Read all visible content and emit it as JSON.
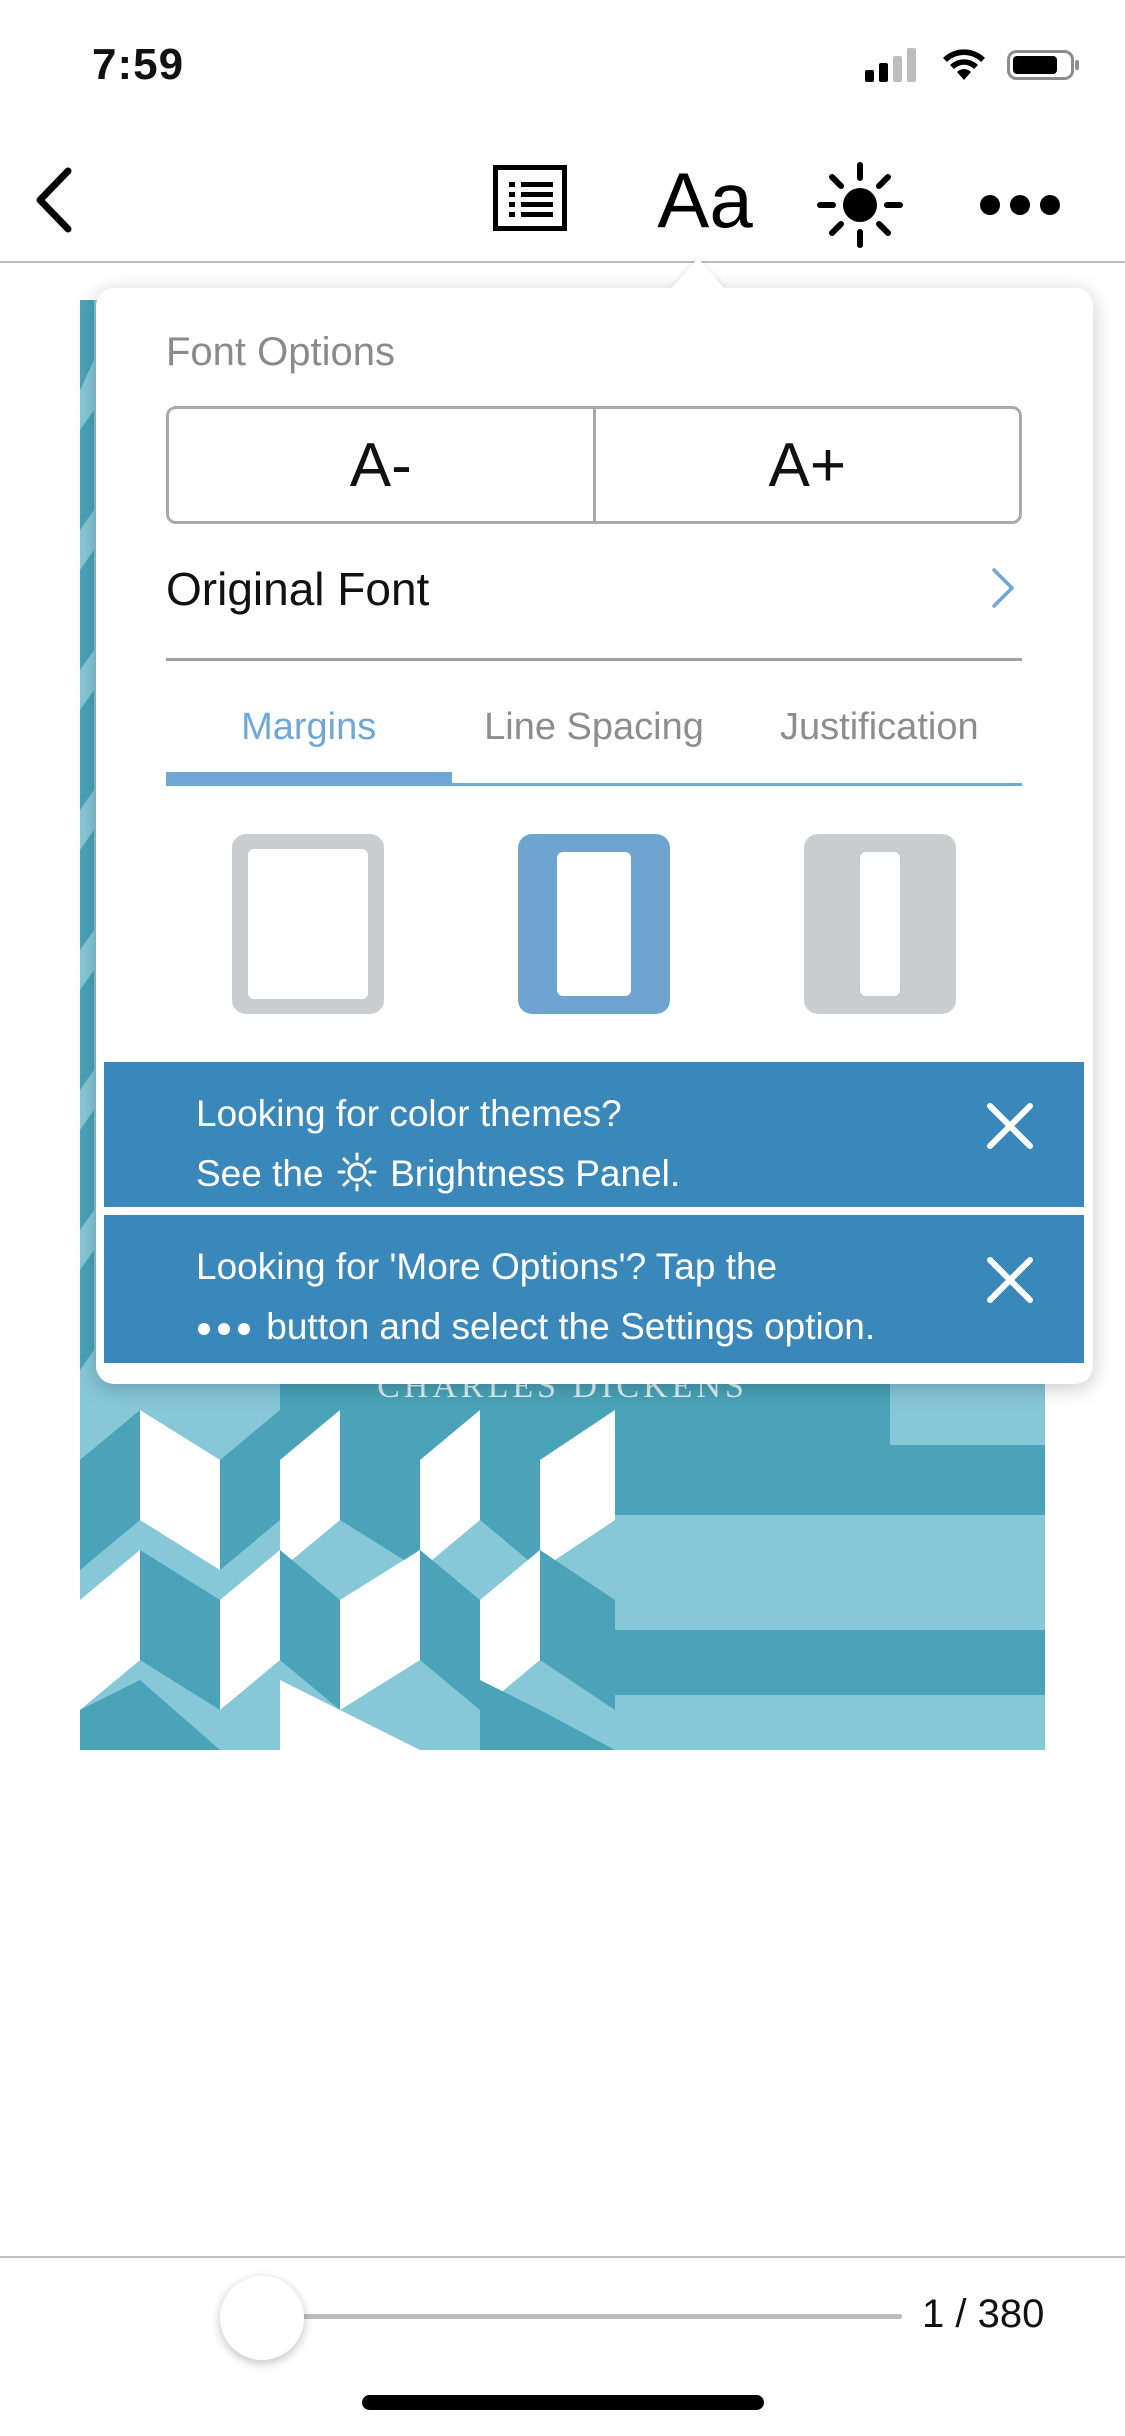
{
  "status_bar": {
    "time": "7:59",
    "icons": [
      "cellular-signal-icon",
      "wifi-icon",
      "battery-icon"
    ]
  },
  "toolbar": {
    "icons": [
      "back-chevron-icon",
      "table-of-contents-icon",
      "font-settings-icon",
      "brightness-icon",
      "more-options-icon"
    ],
    "font_button_label": "Aa"
  },
  "book_cover": {
    "author": "CHARLES DICKENS",
    "colors": {
      "light": "#86c8d8",
      "mid": "#4aa3b8",
      "white": "#ffffff"
    }
  },
  "font_panel": {
    "title": "Font Options",
    "decrease_label": "A-",
    "increase_label": "A+",
    "original_font_label": "Original Font",
    "tabs": [
      {
        "label": "Margins",
        "active": true
      },
      {
        "label": "Line Spacing",
        "active": false
      },
      {
        "label": "Justification",
        "active": false
      }
    ],
    "margin_options": [
      {
        "name": "narrow",
        "selected": false
      },
      {
        "name": "medium",
        "selected": true
      },
      {
        "name": "wide",
        "selected": false
      }
    ],
    "accent_color": "#6fa7d6"
  },
  "banners": {
    "color_themes_line1": "Looking for color themes?",
    "color_themes_line2_before": "See the",
    "color_themes_line2_after": "Brightness Panel.",
    "more_options_line1": "Looking for 'More Options'? Tap the",
    "more_options_line2_after": "button and select the Settings option.",
    "background_color": "#3a88b9"
  },
  "bottom_bar": {
    "page_indicator": "1 / 380",
    "progress": 0
  }
}
